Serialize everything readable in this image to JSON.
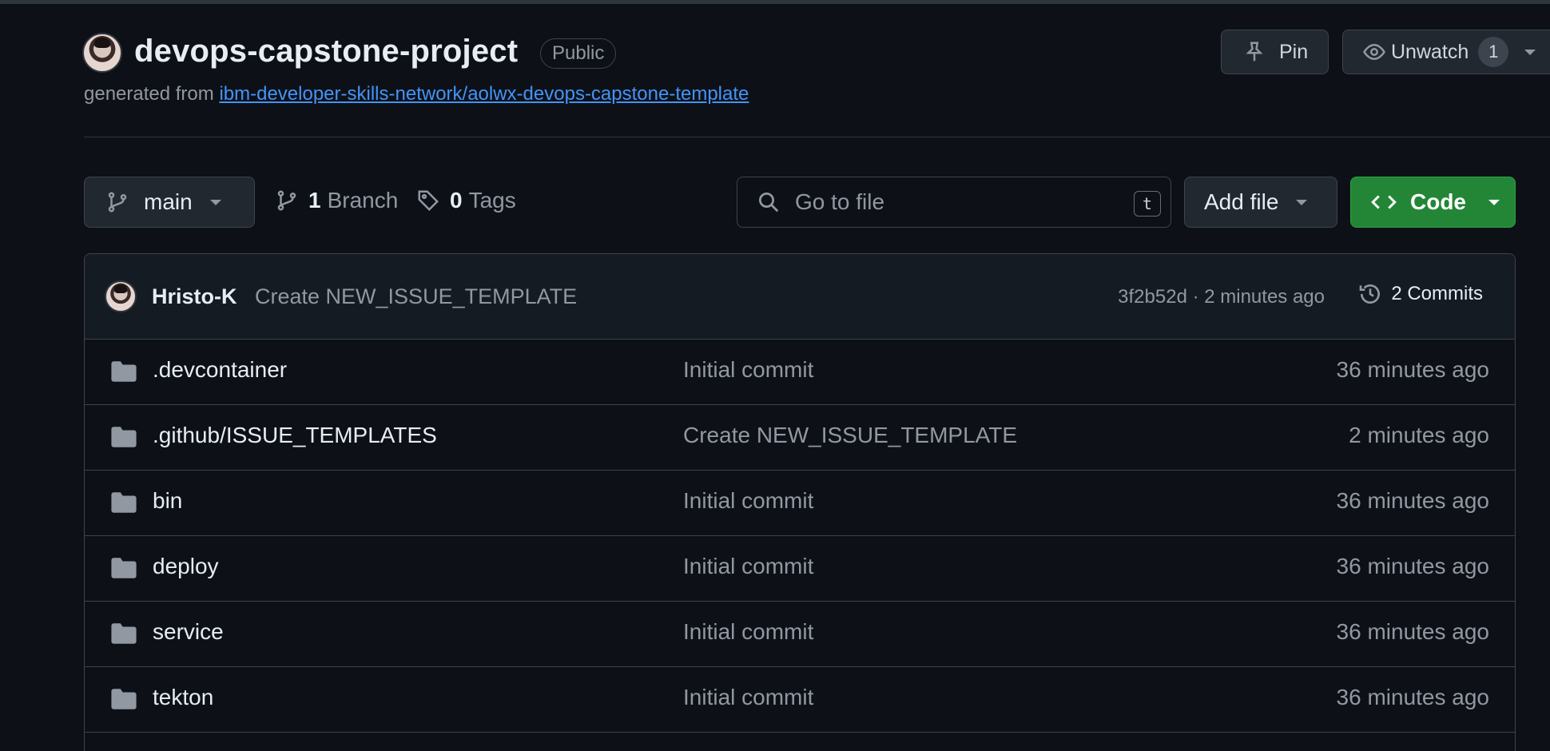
{
  "repo": {
    "name": "devops-capstone-project",
    "visibility": "Public",
    "generated_prefix": "generated from",
    "template_link": "ibm-developer-skills-network/aolwx-devops-capstone-template"
  },
  "header_actions": {
    "pin_label": "Pin",
    "unwatch_label": "Unwatch",
    "watch_count": "1"
  },
  "toolbar": {
    "branch_name": "main",
    "branches_count": "1",
    "branches_label": "Branch",
    "tags_count": "0",
    "tags_label": "Tags",
    "search_placeholder": "Go to file",
    "search_shortcut": "t",
    "add_file_label": "Add file",
    "code_label": "Code"
  },
  "latest_commit": {
    "author": "Hristo-K",
    "message": "Create NEW_ISSUE_TEMPLATE",
    "sha_time": "3f2b52d · 2 minutes ago",
    "commits_label": "2 Commits"
  },
  "files": [
    {
      "name": ".devcontainer",
      "message": "Initial commit",
      "time": "36 minutes ago"
    },
    {
      "name": ".github/ISSUE_TEMPLATES",
      "message": "Create NEW_ISSUE_TEMPLATE",
      "time": "2 minutes ago"
    },
    {
      "name": "bin",
      "message": "Initial commit",
      "time": "36 minutes ago"
    },
    {
      "name": "deploy",
      "message": "Initial commit",
      "time": "36 minutes ago"
    },
    {
      "name": "service",
      "message": "Initial commit",
      "time": "36 minutes ago"
    },
    {
      "name": "tekton",
      "message": "Initial commit",
      "time": "36 minutes ago"
    }
  ],
  "colors": {
    "background": "#0d1117",
    "link": "#4493f8",
    "code_button": "#238636",
    "muted_text": "#9198a1"
  },
  "icons": [
    "pin-icon",
    "eye-icon",
    "git-branch-icon",
    "tag-icon",
    "search-icon",
    "code-icon",
    "history-icon",
    "folder-icon",
    "chevron-down-icon"
  ]
}
